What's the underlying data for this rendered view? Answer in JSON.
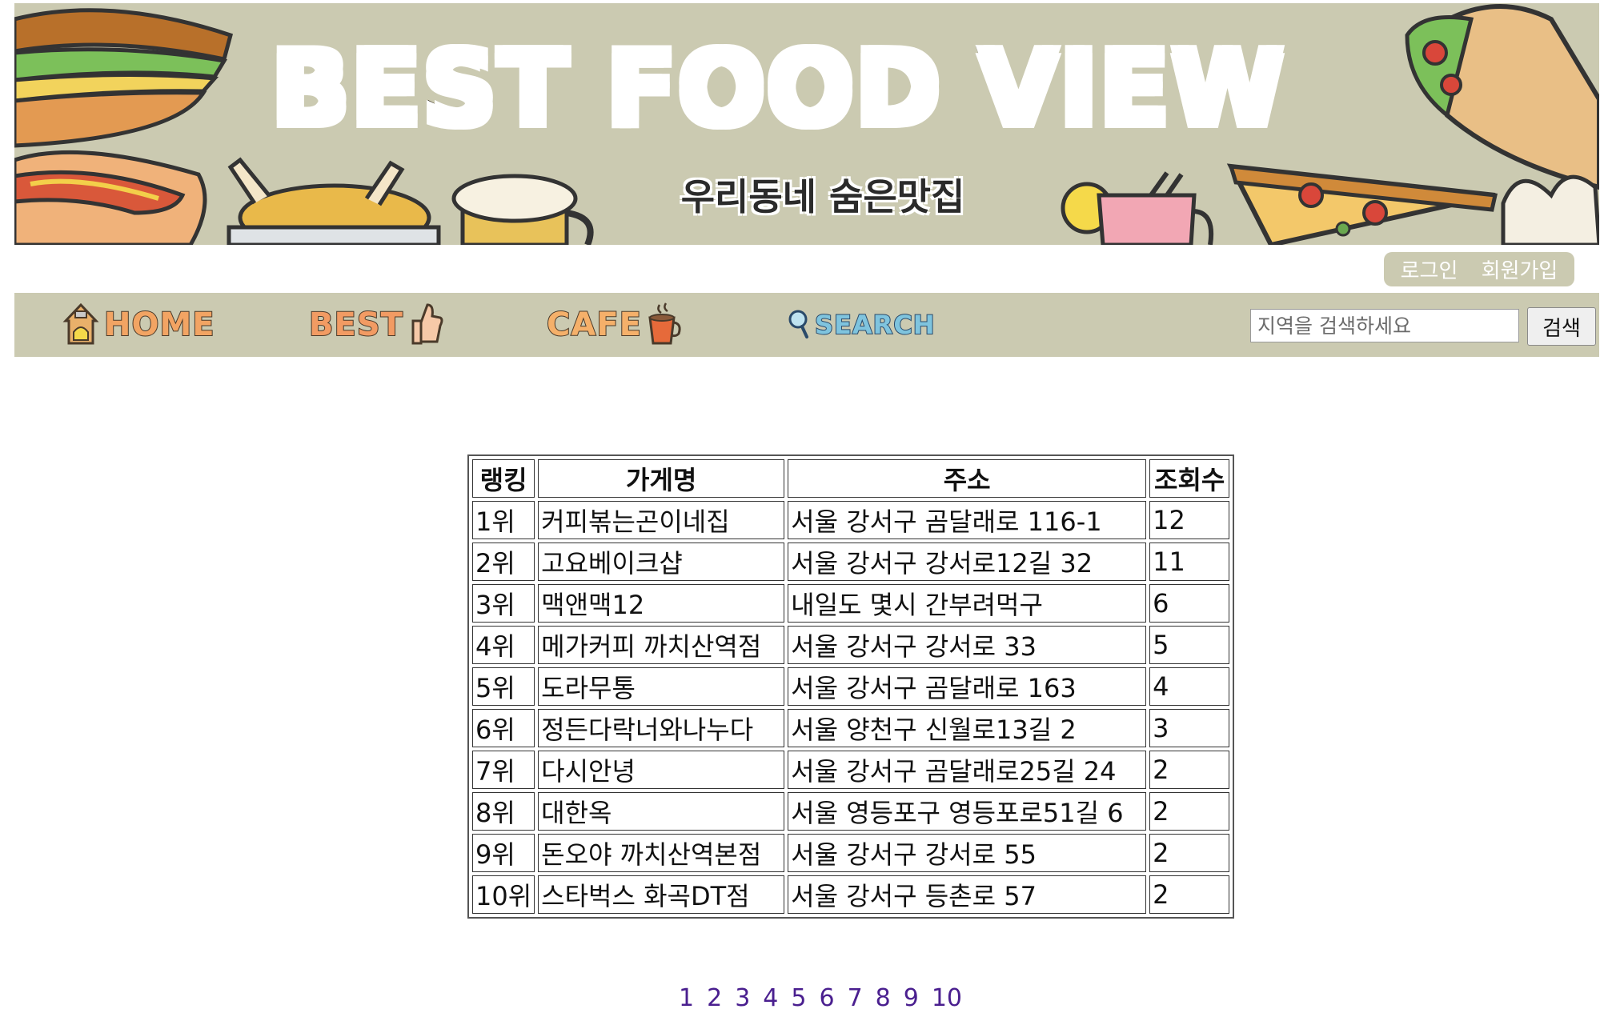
{
  "banner": {
    "title_words": [
      "BEST",
      "FOOD",
      "VIEW"
    ],
    "subtitle": "우리동네 숨은맛집",
    "background_color": "#cbcab1",
    "decorations": [
      "burger-icon",
      "hotdog-icon",
      "chicken-icon",
      "beer-icon",
      "lemonade-icon",
      "pizza-icon",
      "taco-icon",
      "dumpling-icon"
    ]
  },
  "auth": {
    "login": "로그인",
    "signup": "회원가입"
  },
  "nav": {
    "items": [
      {
        "label": "HOME",
        "icon": "house-icon"
      },
      {
        "label": "BEST",
        "icon": "thumbs-up-icon"
      },
      {
        "label": "CAFE",
        "icon": "coffee-cup-icon"
      },
      {
        "label": "SEARCH",
        "icon": "magnifier-icon"
      }
    ],
    "search_placeholder": "지역을 검색하세요",
    "search_button": "검색"
  },
  "table": {
    "headers": [
      "랭킹",
      "가게명",
      "주소",
      "조회수"
    ],
    "rows": [
      [
        "1위",
        "커피볶는곤이네집",
        "서울 강서구 곰달래로 116-1",
        "12"
      ],
      [
        "2위",
        "고요베이크샵",
        "서울 강서구 강서로12길 32",
        "11"
      ],
      [
        "3위",
        "맥앤맥12",
        "내일도 몇시 간부려먹구",
        "6"
      ],
      [
        "4위",
        "메가커피 까치산역점",
        "서울 강서구 강서로 33",
        "5"
      ],
      [
        "5위",
        "도라무통",
        "서울 강서구 곰달래로 163",
        "4"
      ],
      [
        "6위",
        "정든다락너와나누다",
        "서울 양천구 신월로13길 2",
        "3"
      ],
      [
        "7위",
        "다시안녕",
        "서울 강서구 곰달래로25길 24",
        "2"
      ],
      [
        "8위",
        "대한옥",
        "서울 영등포구 영등포로51길 6",
        "2"
      ],
      [
        "9위",
        "돈오야 까치산역본점",
        "서울 강서구 강서로 55",
        "2"
      ],
      [
        "10위",
        "스타벅스 화곡DT점",
        "서울 강서구 등촌로 57",
        "2"
      ]
    ]
  },
  "pagination": [
    "1",
    "2",
    "3",
    "4",
    "5",
    "6",
    "7",
    "8",
    "9",
    "10"
  ],
  "colors": {
    "accent": "#cbcab1",
    "link": "#4a1f8f"
  }
}
